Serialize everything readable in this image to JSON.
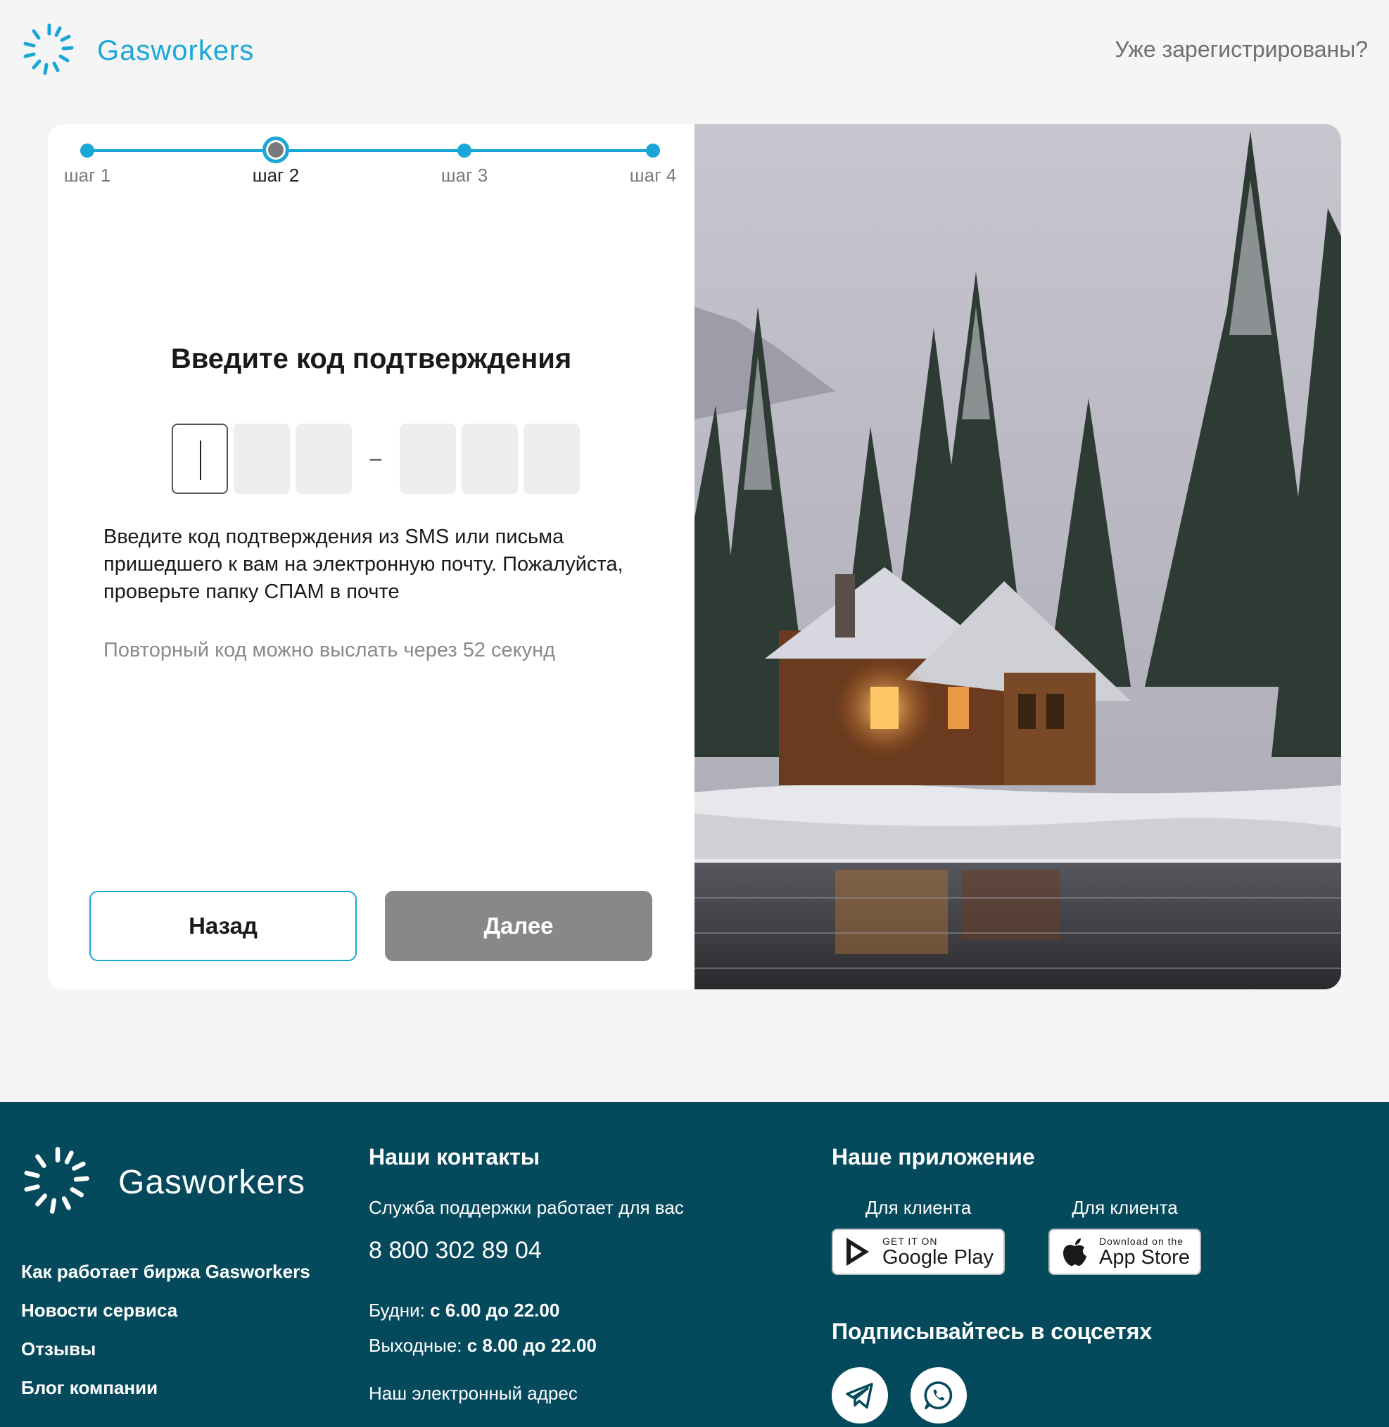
{
  "header": {
    "logo_text": "Gasworkers",
    "login_link": "Уже зарегистрированы?"
  },
  "stepper": {
    "steps": [
      {
        "label": "шаг 1"
      },
      {
        "label": "шаг 2"
      },
      {
        "label": "шаг 3"
      },
      {
        "label": "шаг 4"
      }
    ],
    "active_step": 2
  },
  "form": {
    "title": "Введите код подтверждения",
    "code_separator": "–",
    "description": "Введите код подтверждения из SMS или письма пришедшего к вам на электронную почту. Пожалуйста, проверьте папку СПАМ в почте",
    "resend_text": "Повторный код можно выслать через 52 секунд",
    "back_label": "Назад",
    "next_label": "Далее"
  },
  "footer": {
    "logo_text": "Gasworkers",
    "links": [
      "Как работает биржа Gasworkers",
      "Новости сервиса",
      "Отзывы",
      "Блог компании"
    ],
    "contacts": {
      "heading": "Наши контакты",
      "support": "Служба поддержки работает для вас",
      "phone": "8 800 302 89 04",
      "weekdays_label": "Будни:",
      "weekdays_hours": "с 6.00 до 22.00",
      "weekend_label": "Выходные:",
      "weekend_hours": "с 8.00 до 22.00",
      "email_label": "Наш электронный адрес"
    },
    "app": {
      "heading": "Наше приложение",
      "google_for": "Для клиента",
      "google_small": "GET IT ON",
      "google_big": "Google Play",
      "apple_for": "Для клиента",
      "apple_small": "Download on the",
      "apple_big": "App Store"
    },
    "social_heading": "Подписывайтесь в соцсетях",
    "socials": [
      "telegram-icon",
      "whatsapp-icon"
    ]
  },
  "colors": {
    "accent": "#1aa7d8",
    "footer_bg": "#054a5c",
    "disabled_button": "#888888"
  }
}
